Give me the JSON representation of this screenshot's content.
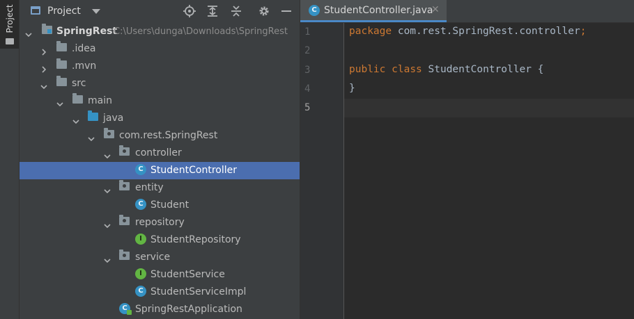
{
  "toolstrip": {
    "label": "Project"
  },
  "panel": {
    "title": "Project",
    "toolbar_icons": [
      "locate-icon",
      "expand-all-icon",
      "collapse-all-icon",
      "gear-icon",
      "hide-icon"
    ]
  },
  "tree": [
    {
      "label": "SpringRest",
      "path": "C:\\Users\\dunga\\Downloads\\SpringRest",
      "icon": "module-folder",
      "expanded": true,
      "bold": true
    },
    {
      "label": ".idea",
      "icon": "folder",
      "expanded": false
    },
    {
      "label": ".mvn",
      "icon": "folder",
      "expanded": false
    },
    {
      "label": "src",
      "icon": "folder",
      "expanded": true
    },
    {
      "label": "main",
      "icon": "folder",
      "expanded": true
    },
    {
      "label": "java",
      "icon": "source-folder",
      "expanded": true
    },
    {
      "label": "com.rest.SpringRest",
      "icon": "package",
      "expanded": true
    },
    {
      "label": "controller",
      "icon": "package",
      "expanded": true
    },
    {
      "label": "StudentController",
      "icon": "class",
      "selected": true
    },
    {
      "label": "entity",
      "icon": "package",
      "expanded": true
    },
    {
      "label": "Student",
      "icon": "class"
    },
    {
      "label": "repository",
      "icon": "package",
      "expanded": true
    },
    {
      "label": "StudentRepository",
      "icon": "interface"
    },
    {
      "label": "service",
      "icon": "package",
      "expanded": true
    },
    {
      "label": "StudentService",
      "icon": "interface"
    },
    {
      "label": "StudentServiceImpl",
      "icon": "class"
    },
    {
      "label": "SpringRestApplication",
      "icon": "spring-boot-class"
    }
  ],
  "editor": {
    "tab": {
      "label": "StudentController.java",
      "close": "✕"
    },
    "line_numbers": [
      "1",
      "2",
      "3",
      "4",
      "5"
    ],
    "current_line": "5",
    "code": {
      "line1_kw": "package",
      "line1_rest": " com.rest.SpringRest.controller",
      "line1_semi": ";",
      "line3_kw1": "public",
      "line3_kw2": "class",
      "line3_name": "StudentController",
      "line3_brace": " {",
      "line4": "}"
    }
  },
  "colors": {
    "selection": "#4b6eaf",
    "keyword": "#cc7832",
    "class_icon": "#3592c4",
    "interface_icon": "#62b543"
  }
}
